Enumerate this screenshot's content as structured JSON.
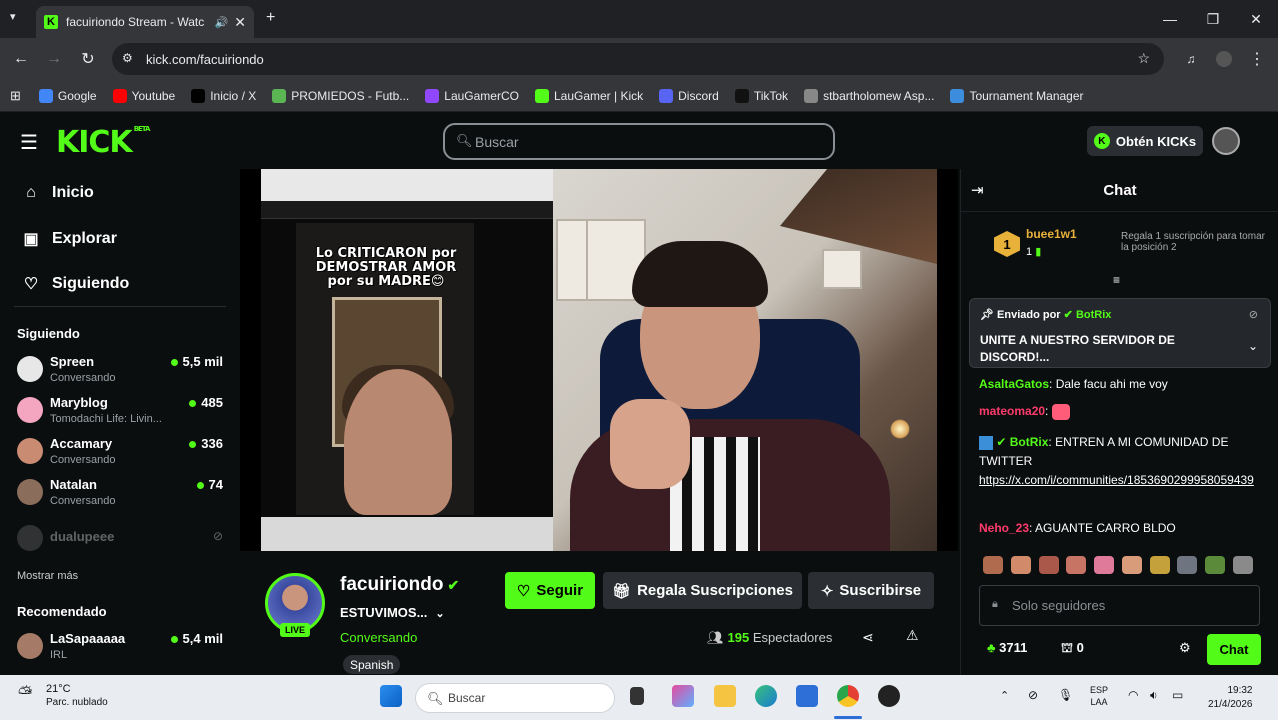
{
  "browser": {
    "tab_title": "facuiriondo Stream - Watc",
    "url": "kick.com/facuiriondo",
    "bookmarks": [
      {
        "label": "Google",
        "icon": "google-icon",
        "color": "#4285f4"
      },
      {
        "label": "Youtube",
        "icon": "youtube-icon",
        "color": "#ff0000"
      },
      {
        "label": "Inicio / X",
        "icon": "x-icon",
        "color": "#000000"
      },
      {
        "label": "PROMIEDOS - Futb...",
        "icon": "promiedos-icon",
        "color": "#5ab552"
      },
      {
        "label": "LauGamerCO",
        "icon": "twitch-icon",
        "color": "#9146ff"
      },
      {
        "label": "LauGamer | Kick",
        "icon": "kick-icon",
        "color": "#53fc18"
      },
      {
        "label": "Discord",
        "icon": "discord-icon",
        "color": "#5865f2"
      },
      {
        "label": "TikTok",
        "icon": "tiktok-icon",
        "color": "#111111"
      },
      {
        "label": "stbartholomew Asp...",
        "icon": "site-icon",
        "color": "#888888"
      },
      {
        "label": "Tournament Manager",
        "icon": "tournament-icon",
        "color": "#3c8dde"
      }
    ]
  },
  "header": {
    "logo": "KICK",
    "logo_badge": "BETA",
    "search_placeholder": "Buscar",
    "get_kicks": "Obtén KICKs"
  },
  "sidebar": {
    "nav": [
      {
        "label": "Inicio",
        "icon": "home-icon"
      },
      {
        "label": "Explorar",
        "icon": "explore-icon"
      },
      {
        "label": "Siguiendo",
        "icon": "heart-icon"
      }
    ],
    "following_header": "Siguiendo",
    "following": [
      {
        "name": "Spreen",
        "sub": "Conversando",
        "viewers": "5,5 mil",
        "color": "#e7e7e7"
      },
      {
        "name": "Maryblog",
        "sub": "Tomodachi Life: Livin...",
        "viewers": "485",
        "color": "#f4a6c0"
      },
      {
        "name": "Accamary",
        "sub": "Conversando",
        "viewers": "336",
        "color": "#c98b72"
      },
      {
        "name": "Natalan",
        "sub": "Conversando",
        "viewers": "74",
        "color": "#8b6d5c"
      }
    ],
    "offline": {
      "name": "dualupeee"
    },
    "show_more": "Mostrar más",
    "recommended_header": "Recomendado",
    "recommended": [
      {
        "name": "LaSapaaaaa",
        "sub": "IRL",
        "viewers": "5,4 mil",
        "color": "#a57a66"
      }
    ]
  },
  "video": {
    "overlay_text": "Lo CRITICARON por DEMOSTRAR AMOR por su MADRE😊"
  },
  "stream": {
    "name": "facuiriondo",
    "live_badge": "LIVE",
    "title": "ESTUVIMOS...",
    "category": "Conversando",
    "language": "Spanish",
    "follow": "Seguir",
    "gift": "Regala Suscripciones",
    "subscribe": "Suscribirse",
    "viewers_count": "195",
    "viewers_label": "Espectadores"
  },
  "chat": {
    "header": "Chat",
    "top_gifter": {
      "rank": "1",
      "name": "buee1w1",
      "count": "1",
      "prompt": "Regala 1 suscripción para tomar la posición 2"
    },
    "pinned": {
      "sent_by": "Enviado por",
      "bot": "BotRix",
      "message": "UNITE A NUESTRO SERVIDOR DE DISCORD!..."
    },
    "messages": [
      {
        "user": "AsaltaGatos",
        "color": "#53fc18",
        "text": "Dale facu ahi me voy",
        "link": ""
      },
      {
        "user": "mateoma20",
        "color": "#ff3b6b",
        "text": "",
        "link": ""
      },
      {
        "user": "BotRix",
        "color": "#53fc18",
        "text": "ENTREN A MI COMUNIDAD DE TWITTER",
        "link": "https://x.com/i/communities/1853690299958059439"
      },
      {
        "user": "Neho_23",
        "color": "#ff3b6b",
        "text": "AGUANTE CARRO BLDO",
        "link": ""
      }
    ],
    "input_placeholder": "Solo seguidores",
    "points": "3711",
    "bag_count": "0",
    "send": "Chat"
  },
  "taskbar": {
    "temp": "21°C",
    "weather": "Parc. nublado",
    "search": "Buscar",
    "lang_top": "ESP",
    "lang_bottom": "LAA",
    "time": "19:32",
    "date": "21/4/2026"
  }
}
